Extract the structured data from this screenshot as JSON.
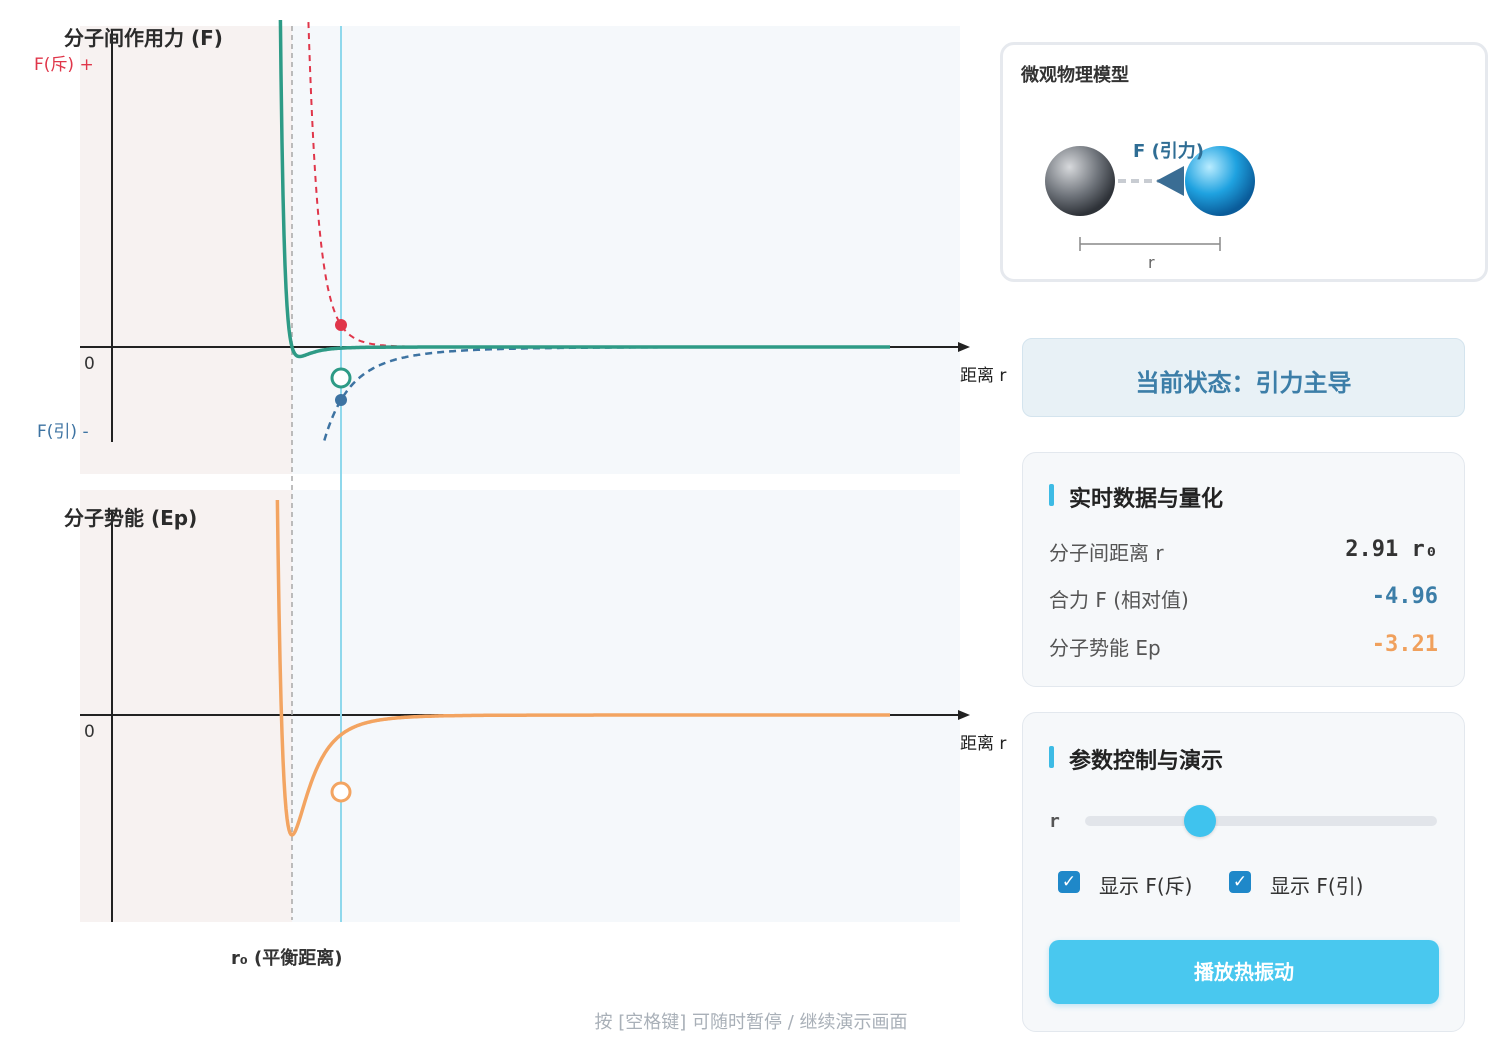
{
  "charts": {
    "force": {
      "title": "分子间作用力 (F)",
      "repel_label": "F(斥) +",
      "attract_label": "F(引) -",
      "zero_label": "0",
      "x_label": "距离 r"
    },
    "energy": {
      "title": "分子势能 (Ep)",
      "zero_label": "0",
      "x_label": "距离 r"
    },
    "r0_label": "r₀ (平衡距离)"
  },
  "colors": {
    "net_force": "#2e9b86",
    "repulsion": "#e0364a",
    "attraction": "#3d73a2",
    "energy": "#f3a461",
    "current_marker": "#8fd8ec",
    "equilibrium": "#aaaaaa"
  },
  "chart_data": [
    {
      "type": "line",
      "name": "force",
      "x_range": [
        0,
        1
      ],
      "current_r": 2.91,
      "current_F": -4.96,
      "series": [
        {
          "name": "F(斥)",
          "style": "dashed"
        },
        {
          "name": "F(引)",
          "style": "dashed"
        },
        {
          "name": "F",
          "style": "solid"
        }
      ]
    },
    {
      "type": "line",
      "name": "energy",
      "current_r": 2.91,
      "current_Ep": -3.21,
      "series": [
        {
          "name": "Ep",
          "style": "solid"
        }
      ]
    }
  ],
  "model": {
    "title": "微观物理模型",
    "force_label": "F (引力)",
    "r_label": "r"
  },
  "state": {
    "text": "当前状态：引力主导"
  },
  "data_panel": {
    "title": "实时数据与量化",
    "rows": [
      {
        "label": "分子间距离 r",
        "value": "2.91 r₀",
        "color": "#333333"
      },
      {
        "label": "合力 F (相对值)",
        "value": "-4.96",
        "color": "#3c7ea8"
      },
      {
        "label": "分子势能 Ep",
        "value": "-3.21",
        "color": "#f0a05c"
      }
    ]
  },
  "controls": {
    "title": "参数控制与演示",
    "slider_label": "r",
    "slider_value": 0.33,
    "checkbox_repel": "显示 F(斥)",
    "checkbox_attract": "显示 F(引)",
    "play_button": "播放热振动"
  },
  "hint": "按 [空格键] 可随时暂停 / 继续演示画面"
}
